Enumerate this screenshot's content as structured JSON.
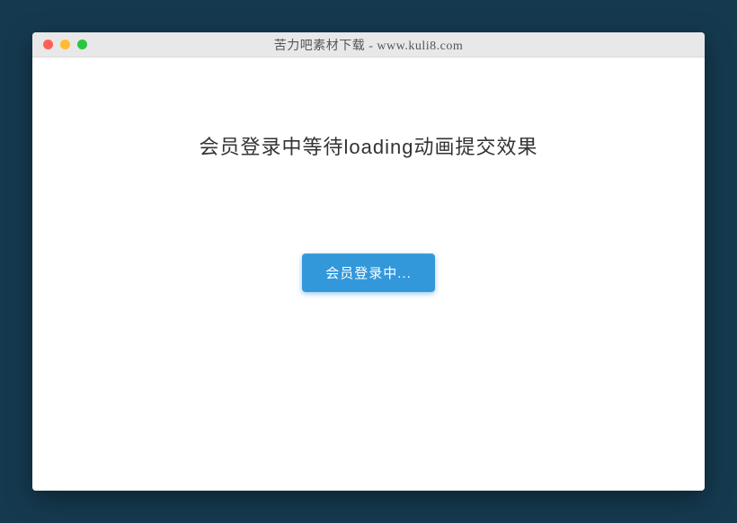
{
  "window": {
    "title": "苦力吧素材下载 - www.kuli8.com"
  },
  "page": {
    "heading": "会员登录中等待loading动画提交效果"
  },
  "button": {
    "label": "会员登录中..."
  }
}
